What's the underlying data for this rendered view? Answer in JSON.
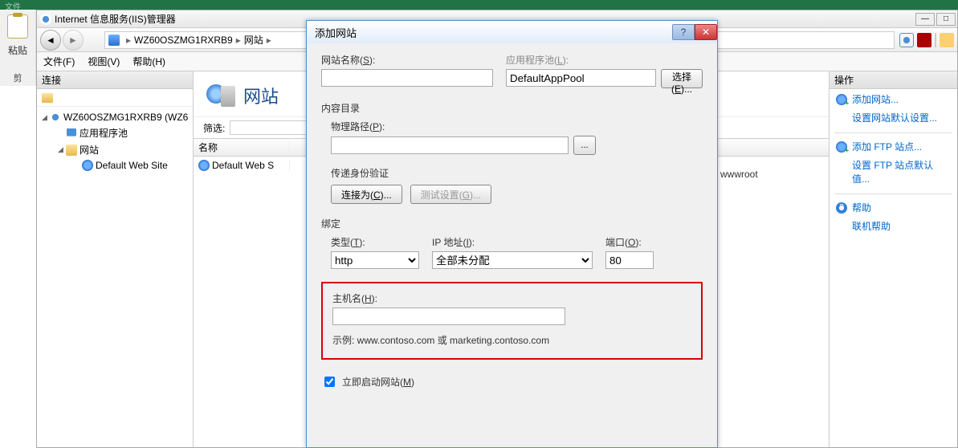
{
  "ribbon": {
    "file": "文件"
  },
  "paste": {
    "label": "粘贴",
    "cut": "剪"
  },
  "iis": {
    "title": "Internet 信息服务(IIS)管理器",
    "breadcrumb": {
      "root": "WZ60OSZMG1RXRB9",
      "sites": "网站"
    },
    "menu": {
      "file": "文件(F)",
      "view": "视图(V)",
      "help": "帮助(H)"
    },
    "tree": {
      "header": "连接",
      "server": "WZ60OSZMG1RXRB9 (WZ6",
      "apppools": "应用程序池",
      "sites": "网站",
      "defaultsite": "Default Web Site"
    },
    "center": {
      "title": "网站",
      "filter_label": "筛选:",
      "col_name": "名称",
      "row_default": "Default Web S"
    },
    "wwwroot": "wwwroot",
    "actions": {
      "header": "操作",
      "add_site": "添加网站...",
      "set_default": "设置网站默认设置...",
      "add_ftp": "添加 FTP 站点...",
      "set_ftp_default": "设置 FTP 站点默认值...",
      "help": "帮助",
      "online_help": "联机帮助"
    }
  },
  "dialog": {
    "title": "添加网站",
    "site_name_label": "网站名称(S):",
    "apppool_label": "应用程序池(L):",
    "apppool_value": "DefaultAppPool",
    "select_btn": "选择(E)...",
    "content_group": "内容目录",
    "phys_path_label": "物理路径(P):",
    "auth_label": "传递身份验证",
    "connect_as": "连接为(C)...",
    "test_settings": "测试设置(G)...",
    "binding_group": "绑定",
    "type_label": "类型(T):",
    "type_value": "http",
    "ip_label": "IP 地址(I):",
    "ip_value": "全部未分配",
    "port_label": "端口(O):",
    "port_value": "80",
    "hostname_label": "主机名(H):",
    "example": "示例: www.contoso.com 或 marketing.contoso.com",
    "start_immediately": "立即启动网站(M)"
  }
}
